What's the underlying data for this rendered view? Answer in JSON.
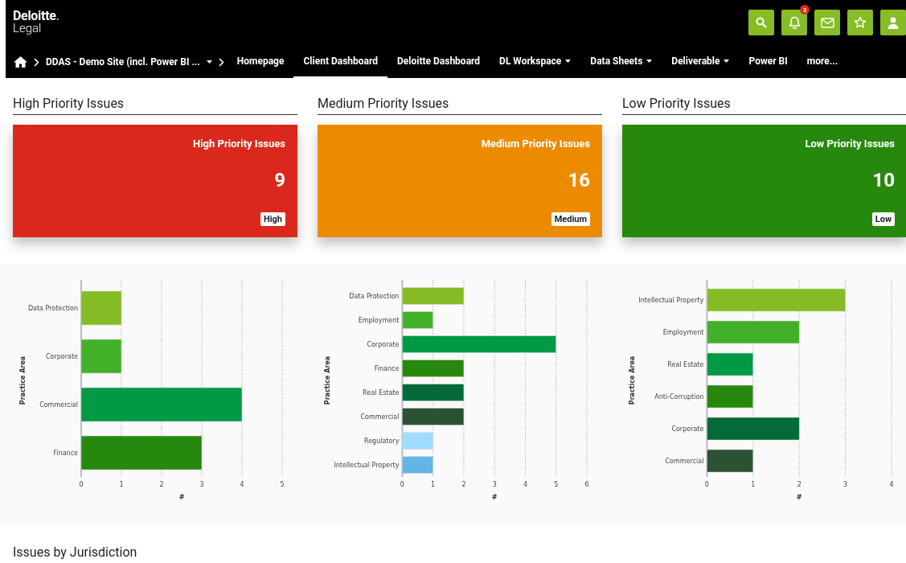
{
  "header": {
    "logo": {
      "brand": "Deloitte",
      "dot": ".",
      "sub": "Legal"
    },
    "notifications": {
      "count": "3"
    },
    "breadcrumb": {
      "site": "DDAS - Demo Site (incl. Power BI ..."
    },
    "nav": [
      {
        "label": "Homepage",
        "selected": false,
        "dropdown": false
      },
      {
        "label": "Client Dashboard",
        "selected": true,
        "dropdown": false
      },
      {
        "label": "Deloitte Dashboard",
        "selected": false,
        "dropdown": false
      },
      {
        "label": "DL Workspace",
        "selected": false,
        "dropdown": true
      },
      {
        "label": "Data Sheets",
        "selected": false,
        "dropdown": true
      },
      {
        "label": "Deliverable",
        "selected": false,
        "dropdown": true
      },
      {
        "label": "Power BI",
        "selected": false,
        "dropdown": false
      },
      {
        "label": "more...",
        "selected": false,
        "dropdown": false
      }
    ]
  },
  "panels": [
    {
      "heading": "High Priority Issues",
      "card": {
        "title": "High Priority Issues",
        "count": "9",
        "tag": "High",
        "color": "#da291c"
      },
      "chart_data": {
        "type": "bar",
        "orientation": "horizontal",
        "grid": true,
        "ylabel": "Practice Area",
        "xlabel": "#",
        "categories": [
          "Data Protection",
          "Corporate",
          "Commercial",
          "Finance"
        ],
        "values": [
          1,
          1,
          4,
          3
        ],
        "colors": [
          "#86bc25",
          "#43b02a",
          "#009a44",
          "#26890d"
        ],
        "xlim": [
          0,
          5
        ],
        "xticks": [
          0,
          1,
          2,
          3,
          4,
          5
        ]
      }
    },
    {
      "heading": "Medium Priority Issues",
      "card": {
        "title": "Medium Priority Issues",
        "count": "16",
        "tag": "Medium",
        "color": "#ed8b00"
      },
      "chart_data": {
        "type": "bar",
        "orientation": "horizontal",
        "grid": true,
        "ylabel": "Practice Area",
        "xlabel": "#",
        "categories": [
          "Data Protection",
          "Employment",
          "Corporate",
          "Finance",
          "Real Estate",
          "Commercial",
          "Regulatory",
          "Intellectual Property"
        ],
        "values": [
          2,
          1,
          5,
          2,
          2,
          2,
          1,
          1
        ],
        "colors": [
          "#86bc25",
          "#43b02a",
          "#009a44",
          "#26890d",
          "#046a38",
          "#2c5234",
          "#a0dcff",
          "#62b5e5"
        ],
        "xlim": [
          0,
          6
        ],
        "xticks": [
          0,
          1,
          2,
          3,
          4,
          5,
          6
        ]
      }
    },
    {
      "heading": "Low Priority Issues",
      "card": {
        "title": "Low Priority Issues",
        "count": "10",
        "tag": "Low",
        "color": "#26890d"
      },
      "chart_data": {
        "type": "bar",
        "orientation": "horizontal",
        "grid": true,
        "ylabel": "Practice Area",
        "xlabel": "#",
        "categories": [
          "Intellectual Property",
          "Employment",
          "Real Estate",
          "Anti-Corruption",
          "Corporate",
          "Commercial"
        ],
        "values": [
          3,
          2,
          1,
          1,
          2,
          1
        ],
        "colors": [
          "#86bc25",
          "#43b02a",
          "#009a44",
          "#26890d",
          "#046a38",
          "#2c5234"
        ],
        "xlim": [
          0,
          4
        ],
        "xticks": [
          0,
          1,
          2,
          3,
          4
        ]
      }
    }
  ],
  "section": {
    "heading": "Issues by Jurisdiction"
  }
}
